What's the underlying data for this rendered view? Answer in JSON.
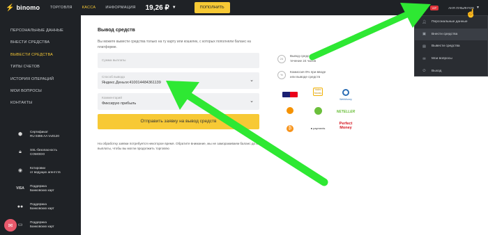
{
  "header": {
    "logo_text": "binomo",
    "nav": [
      "ТОРГОВЛЯ",
      "КАССА",
      "ИНФОРМАЦИЯ"
    ],
    "active_nav": 1,
    "balance": "19,26 ₽",
    "deposit_label": "ПОПОЛНИТЬ",
    "vip_badge": "VIP",
    "user_name": "АНЯ ЛУКЬЯНЧУК"
  },
  "sidebar": {
    "items": [
      {
        "label": "ПЕРСОНАЛЬНЫЕ ДАННЫЕ"
      },
      {
        "label": "ВНЕСТИ СРЕДСТВА"
      },
      {
        "label": "ВЫВЕСТИ СРЕДСТВА"
      },
      {
        "label": "ТИПЫ СЧЕТОВ"
      },
      {
        "label": "ИСТОРИЯ ОПЕРАЦИЙ"
      },
      {
        "label": "МОИ ВОПРОСЫ"
      },
      {
        "label": "КОНТАКТЫ"
      }
    ],
    "active_index": 2,
    "badges": [
      {
        "line1": "Сертификат",
        "line2": "RU 0395 AA Vv0120",
        "icon": "certificate-icon"
      },
      {
        "line1": "SSL-безопасность",
        "line2": "COMODO",
        "icon": "lock-icon"
      },
      {
        "line1": "Котировки",
        "line2": "от ведущих агентств",
        "icon": "quotes-icon"
      },
      {
        "line1": "Поддержка",
        "line2": "Банковских карт",
        "icon": "visa-icon"
      },
      {
        "line1": "Поддержка",
        "line2": "Банковских карт",
        "icon": "mastercard-icon"
      },
      {
        "line1": "Поддержка",
        "line2": "Банковских карт",
        "icon": "card-icon"
      }
    ]
  },
  "main": {
    "title": "Вывод средств",
    "description": "Вы можете вывести средства только на ту карту или кошелек, с которых пополняли баланс на платформе.",
    "amount_placeholder": "Сумма выплаты",
    "method_label": "Способ вывода",
    "method_value": "Яндекс.Деньги:410014484361139",
    "comment_label": "Комментарий",
    "comment_value": "Фиксирую прибыль",
    "submit_label": "Отправить заявку на вывод средств",
    "note": "На обработку заявки потребуется некоторое время. Обратите внимание, мы не замораживаем баланс до момента выплаты, чтобы вы могли продолжить торговлю",
    "info": [
      {
        "icon_text": "24",
        "line1": "Вывод средств",
        "line2": "течение 24 часов"
      },
      {
        "icon_text": "%",
        "line1": "Комиссия 0% при вводе",
        "line2": "или выводе средств"
      }
    ],
    "payments": [
      "VISA",
      "Yandex Money",
      "WebMoney",
      "QIWI",
      "Neteller",
      "Skrill",
      "ЮКАССА",
      "Bitcoin",
      "Perfect Money"
    ]
  },
  "dropdown": {
    "items": [
      {
        "label": "Персональные данные",
        "icon": "user-icon"
      },
      {
        "label": "Внести средства",
        "icon": "wallet-icon"
      },
      {
        "label": "Вывести средства",
        "icon": "withdraw-icon"
      },
      {
        "label": "Мои вопросы",
        "icon": "chat-icon"
      },
      {
        "label": "Выход",
        "icon": "power-icon"
      }
    ],
    "active_index": 1
  },
  "colors": {
    "accent": "#f7c935",
    "dark": "#1f2226",
    "arrow": "#2ee833"
  }
}
